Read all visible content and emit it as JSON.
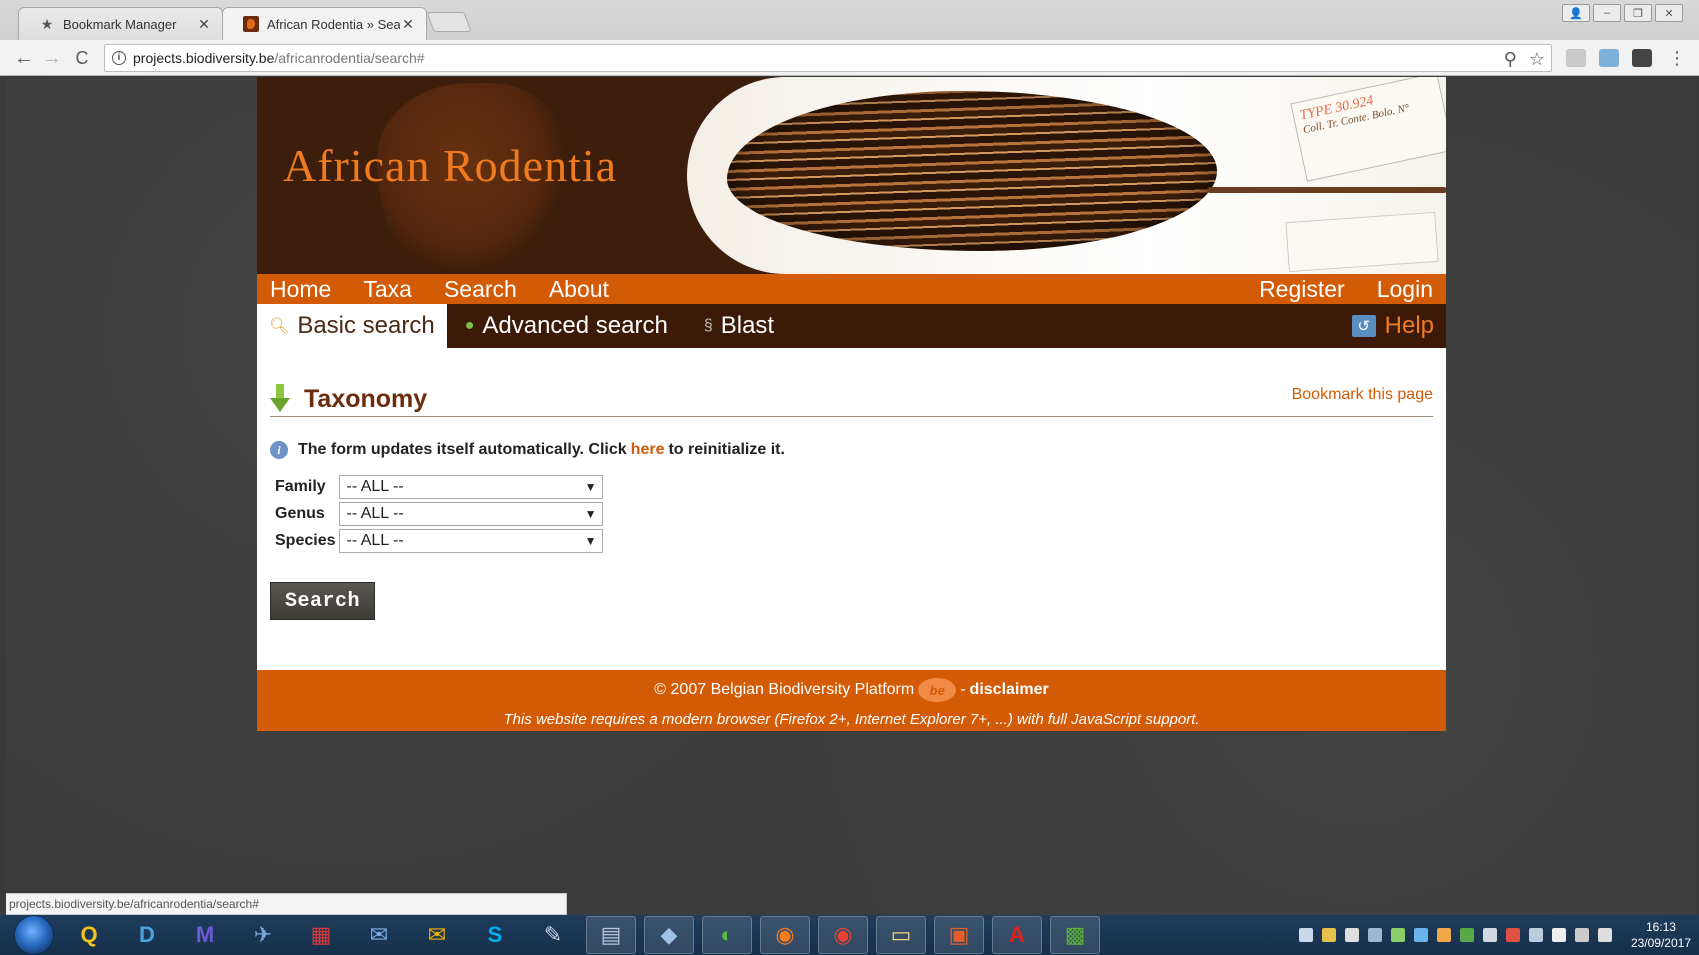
{
  "browser": {
    "tabs": [
      {
        "title": "Bookmark Manager",
        "icon": "star-icon",
        "active": false
      },
      {
        "title": "African Rodentia » Searc",
        "icon": "african-rodentia-favicon",
        "active": true
      }
    ],
    "close_glyph": "✕",
    "back_glyph": "←",
    "forward_glyph": "→",
    "reload_glyph": "C",
    "url_host": "projects.biodiversity.be",
    "url_path": "/africanrodentia/search#",
    "zoom_glyph": "⚲",
    "star_glyph": "☆",
    "menu_glyph": "⋮",
    "window_controls": [
      "👤",
      "–",
      "❐",
      "✕"
    ],
    "status_url": "projects.biodiversity.be/africanrodentia/search#"
  },
  "site": {
    "title": "African Rodentia",
    "specimen_tag_text": "TYPE 30.924",
    "specimen_tag_lines": "Coll. Tr. Conte. Bolo. N°",
    "main_nav": [
      "Home",
      "Taxa",
      "Search",
      "About"
    ],
    "user_nav": [
      "Register",
      "Login"
    ],
    "sub_nav": {
      "basic": "Basic search",
      "advanced": "Advanced search",
      "blast": "Blast",
      "help": "Help"
    },
    "section_title": "Taxonomy",
    "bookmark_link": "Bookmark this page",
    "notice": {
      "before": "The form updates itself automatically. Click",
      "link": "here",
      "after": "to reinitialize it."
    },
    "filters": [
      {
        "label": "Family",
        "value": "-- ALL --"
      },
      {
        "label": "Genus",
        "value": "-- ALL --"
      },
      {
        "label": "Species",
        "value": "-- ALL --"
      }
    ],
    "search_button": "Search",
    "footer": {
      "copyright": "© 2007 Belgian Biodiversity Platform",
      "logo": "be",
      "separator": "-",
      "disclaimer": "disclaimer",
      "browser_note": "This website requires a modern browser (Firefox 2+, Internet Explorer 7+, ...) with full JavaScript support."
    }
  },
  "taskbar": {
    "apps": [
      {
        "name": "qgis",
        "glyph": "Q",
        "color": "#f0c419"
      },
      {
        "name": "directory-opus",
        "glyph": "D",
        "color": "#4aa3df"
      },
      {
        "name": "app3",
        "glyph": "M",
        "color": "#6b5bd6"
      },
      {
        "name": "app4",
        "glyph": "✈",
        "color": "#7aa7d8"
      },
      {
        "name": "app5",
        "glyph": "▦",
        "color": "#d93a3a"
      },
      {
        "name": "thunderbird",
        "glyph": "✉",
        "color": "#7fb3e8"
      },
      {
        "name": "outlook-folder",
        "glyph": "✉",
        "color": "#f4b400"
      },
      {
        "name": "skype",
        "glyph": "S",
        "color": "#00aff0"
      },
      {
        "name": "app9",
        "glyph": "✎",
        "color": "#c9d7ea"
      },
      {
        "name": "calculator",
        "glyph": "▤",
        "color": "#b8c6d8"
      },
      {
        "name": "app11",
        "glyph": "◆",
        "color": "#9cc3e6"
      },
      {
        "name": "app12",
        "glyph": "◐",
        "color": "#5bbf3c"
      },
      {
        "name": "firefox",
        "glyph": "◉",
        "color": "#f37b1d"
      },
      {
        "name": "chrome",
        "glyph": "◉",
        "color": "#e44134"
      },
      {
        "name": "file-explorer",
        "glyph": "▭",
        "color": "#f3d27a"
      },
      {
        "name": "app16",
        "glyph": "▣",
        "color": "#e85c2a"
      },
      {
        "name": "acrobat",
        "glyph": "A",
        "color": "#e02020"
      },
      {
        "name": "app18",
        "glyph": "▩",
        "color": "#5caf3a"
      }
    ],
    "clock_time": "16:13",
    "clock_date": "23/09/2017"
  }
}
